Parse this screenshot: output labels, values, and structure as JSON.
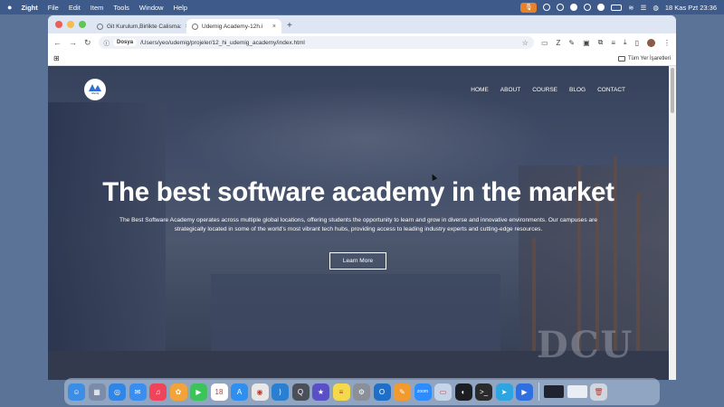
{
  "menubar": {
    "app": "Zight",
    "items": [
      "File",
      "Edit",
      "Item",
      "Tools",
      "Window",
      "Help"
    ],
    "clock": "18 Kas Pzt  23:36"
  },
  "browser": {
    "tabs": [
      {
        "title": "Git Kurulum,Birlikte Calisma:",
        "active": false
      },
      {
        "title": "Udemig Academy-12h.i",
        "active": true
      }
    ],
    "new_tab": "+",
    "address": {
      "scheme_label": "Dosya",
      "url": "/Users/yeo/udemig/projeler/12_hi_udemig_academy/index.html"
    },
    "bookmarks": {
      "all_label": "Tüm Yer İşaretleri"
    }
  },
  "site": {
    "logo_text": "Udemig",
    "nav": [
      "HOME",
      "ABOUT",
      "COURSE",
      "BLOG",
      "CONTACT"
    ],
    "hero": {
      "title": "The best software academy in the market",
      "text_line1": "The Best Software Academy operates across multiple global locations, offering students the opportunity to learn and grow in diverse and innovative environments. Our campuses are",
      "text_line2": "strategically located in some of the world's most vibrant tech hubs, providing access to leading industry experts and cutting-edge resources.",
      "button": "Learn More"
    },
    "background_sign": "DCU"
  },
  "dock": {
    "icons": [
      {
        "name": "finder-icon",
        "color": "#3b8de6",
        "glyph": "☺"
      },
      {
        "name": "launchpad-icon",
        "color": "#7a8ca8",
        "glyph": "▦"
      },
      {
        "name": "safari-icon",
        "color": "#2f86e6",
        "glyph": "◎"
      },
      {
        "name": "mail-icon",
        "color": "#3a8ef0",
        "glyph": "✉"
      },
      {
        "name": "music-icon",
        "color": "#f0445a",
        "glyph": "♫"
      },
      {
        "name": "photos-icon",
        "color": "#f2a33a",
        "glyph": "✿"
      },
      {
        "name": "facetime-icon",
        "color": "#3cc35a",
        "glyph": "▶"
      },
      {
        "name": "calendar-icon",
        "color": "#ffffff",
        "glyph": "18"
      },
      {
        "name": "appstore-icon",
        "color": "#2f8ff0",
        "glyph": "A"
      },
      {
        "name": "chrome-icon",
        "color": "#e8e8e8",
        "glyph": "◉"
      },
      {
        "name": "vscode-icon",
        "color": "#2a7fd0",
        "glyph": "⟩"
      },
      {
        "name": "quicktime-icon",
        "color": "#4a4f5a",
        "glyph": "Q"
      },
      {
        "name": "imovie-icon",
        "color": "#5b4fc8",
        "glyph": "★"
      },
      {
        "name": "notes-icon",
        "color": "#f5d94c",
        "glyph": "≡"
      },
      {
        "name": "settings-icon",
        "color": "#8a8f98",
        "glyph": "⚙"
      },
      {
        "name": "outlook-icon",
        "color": "#1d6fc8",
        "glyph": "O"
      },
      {
        "name": "pages-icon",
        "color": "#f29a2e",
        "glyph": "✎"
      },
      {
        "name": "zoom-icon",
        "color": "#2d8cff",
        "glyph": "zoom"
      },
      {
        "name": "preview-icon",
        "color": "#c6d4ea",
        "glyph": "▭"
      },
      {
        "name": "github-icon",
        "color": "#1b1f24",
        "glyph": "◐"
      },
      {
        "name": "terminal-icon",
        "color": "#2b2b2b",
        "glyph": ">_"
      },
      {
        "name": "telegram-icon",
        "color": "#2ca5e0",
        "glyph": "➤"
      },
      {
        "name": "zight-icon",
        "color": "#2f6fe0",
        "glyph": "▶"
      }
    ],
    "right_icons": [
      {
        "name": "screenshot-thumb-icon",
        "color": "#1f2430",
        "glyph": ""
      },
      {
        "name": "window-thumb-icon",
        "color": "#e9edf4",
        "glyph": ""
      },
      {
        "name": "trash-icon",
        "color": "#cfd6e0",
        "glyph": "🗑"
      }
    ]
  }
}
